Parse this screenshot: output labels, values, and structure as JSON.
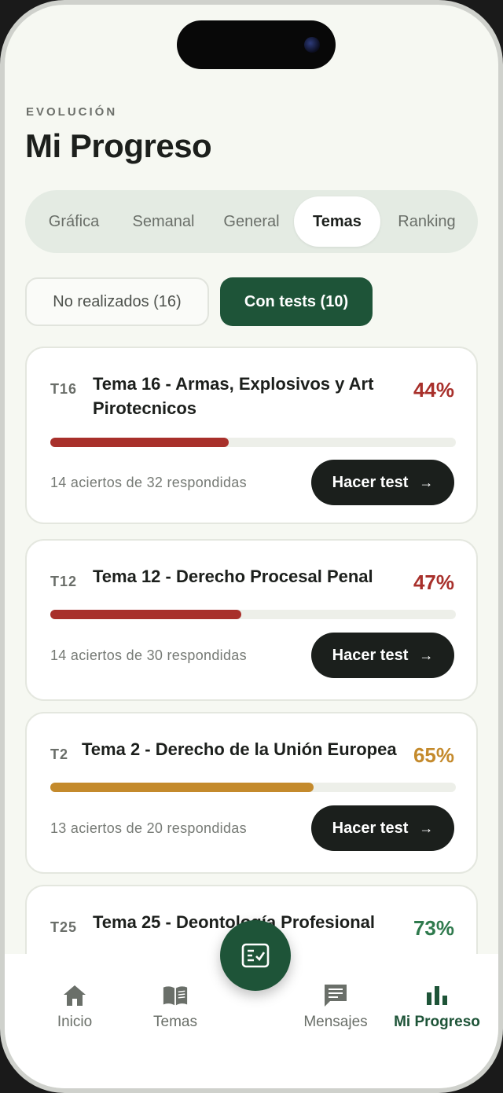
{
  "header": {
    "eyebrow": "EVOLUCIÓN",
    "title": "Mi Progreso"
  },
  "segments": [
    {
      "label": "Gráfica",
      "active": false
    },
    {
      "label": "Semanal",
      "active": false
    },
    {
      "label": "General",
      "active": false
    },
    {
      "label": "Temas",
      "active": true
    },
    {
      "label": "Ranking",
      "active": false
    }
  ],
  "filters": {
    "not_done": "No realizados (16)",
    "with_tests": "Con tests (10)",
    "selected": "with_tests"
  },
  "topics": [
    {
      "code": "T16",
      "title_line1": "Tema 16 - Armas, Explosivos y Art",
      "title_line2": "Pirotecnicos",
      "percent_label": "44%",
      "percent": 44,
      "color": "#a8302b",
      "meta": "14 aciertos de 32 respondidas",
      "button": "Hacer test"
    },
    {
      "code": "T12",
      "title_line1": "Tema 12 - Derecho Procesal Penal",
      "title_line2": "",
      "percent_label": "47%",
      "percent": 47,
      "color": "#a8302b",
      "meta": "14 aciertos de 30 respondidas",
      "button": "Hacer test"
    },
    {
      "code": "T2",
      "title_line1": "Tema 2 - Derecho de la Unión Europea",
      "title_line2": "",
      "percent_label": "65%",
      "percent": 65,
      "color": "#c48a2c",
      "meta": "13 aciertos de 20 respondidas",
      "button": "Hacer test"
    },
    {
      "code": "T25",
      "title_line1": "Tema 25 - Deontología Profesional",
      "title_line2": "",
      "percent_label": "73%",
      "percent": 73,
      "color": "#2f7a4d",
      "meta": "",
      "button": ""
    }
  ],
  "tabbar": {
    "items": [
      {
        "label": "Inicio",
        "icon": "home-icon",
        "active": false
      },
      {
        "label": "Temas",
        "icon": "book-icon",
        "active": false
      },
      {
        "label": "Mensajes",
        "icon": "message-icon",
        "active": false
      },
      {
        "label": "Mi Progreso",
        "icon": "bar-chart-icon",
        "active": true
      }
    ],
    "fab_icon": "checklist-icon"
  },
  "colors": {
    "brand": "#1e5438",
    "dark_button": "#1b1f1c",
    "low": "#a8302b",
    "mid": "#c48a2c",
    "high": "#2f7a4d"
  }
}
